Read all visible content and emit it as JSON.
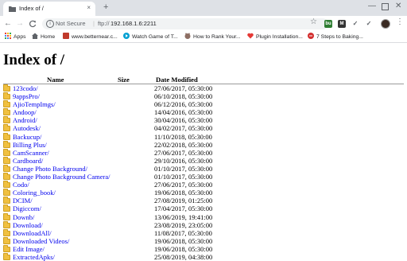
{
  "browser": {
    "tab_title": "Index of /",
    "tab_close": "×",
    "new_tab": "+",
    "window_controls": {
      "minimize": "—",
      "close": "✕"
    },
    "nav": {
      "back": "←",
      "forward": "→",
      "reload": "C"
    },
    "omnibox": {
      "info_icon": "i",
      "security": "Not Secure",
      "separator": "|",
      "scheme": "ftp://",
      "host": "192.168.1.6:2211"
    },
    "star": "☆",
    "extensions": [
      {
        "label": "bu",
        "color": "#2e7d32"
      },
      {
        "label": "M",
        "color": "#333333"
      },
      {
        "label": "✓",
        "color": "#5f6368"
      },
      {
        "label": "✓",
        "color": "#5f6368"
      }
    ],
    "menu": "⋮",
    "bookmarks": [
      {
        "label": "Apps",
        "icon": "apps-grid-icon",
        "color": "#ea4335"
      },
      {
        "label": "Home",
        "icon": "home-icon",
        "color": "#5f6368"
      },
      {
        "label": "www.betternear.c...",
        "icon": "bookmark-favicon",
        "color": "#c0392b"
      },
      {
        "label": "Watch Game of T...",
        "icon": "play-favicon",
        "color": "#00a0d2"
      },
      {
        "label": "How to Rank Your...",
        "icon": "cat-favicon",
        "color": "#8d6e63"
      },
      {
        "label": "Plugin Installation...",
        "icon": "heart-favicon",
        "color": "#e53935"
      },
      {
        "label": "7 Steps to Baking...",
        "icon": "baking-favicon",
        "color": "#d32f2f"
      }
    ]
  },
  "page": {
    "heading": "Index of /",
    "columns": {
      "name": "Name",
      "size": "Size",
      "date": "Date Modified"
    },
    "entries": [
      {
        "name": "123codo/",
        "date": "27/06/2017, 05:30:00"
      },
      {
        "name": "9appsPro/",
        "date": "06/10/2018, 05:30:00"
      },
      {
        "name": "AjioTempImgs/",
        "date": "06/12/2016, 05:30:00"
      },
      {
        "name": "Andoop/",
        "date": "14/04/2016, 05:30:00"
      },
      {
        "name": "Android/",
        "date": "30/04/2016, 05:30:00"
      },
      {
        "name": "Autodesk/",
        "date": "04/02/2017, 05:30:00"
      },
      {
        "name": "Backucup/",
        "date": "11/10/2018, 05:30:00"
      },
      {
        "name": "Billing Plus/",
        "date": "22/02/2018, 05:30:00"
      },
      {
        "name": "CamScanner/",
        "date": "27/06/2017, 05:30:00"
      },
      {
        "name": "Cardboard/",
        "date": "29/10/2016, 05:30:00"
      },
      {
        "name": "Change Photo Background/",
        "date": "01/10/2017, 05:30:00"
      },
      {
        "name": "Change Photo Background Camera/",
        "date": "01/10/2017, 05:30:00"
      },
      {
        "name": "Codo/",
        "date": "27/06/2017, 05:30:00"
      },
      {
        "name": "Coloring_book/",
        "date": "19/06/2018, 05:30:00"
      },
      {
        "name": "DCIM/",
        "date": "27/08/2019, 01:25:00"
      },
      {
        "name": "Digiccom/",
        "date": "17/04/2017, 05:30:00"
      },
      {
        "name": "Downb/",
        "date": "13/06/2019, 19:41:00"
      },
      {
        "name": "Download/",
        "date": "23/08/2019, 23:05:00"
      },
      {
        "name": "DownloadAll/",
        "date": "11/08/2017, 05:30:00"
      },
      {
        "name": "Downloaded Videos/",
        "date": "19/06/2018, 05:30:00"
      },
      {
        "name": "Edit Image/",
        "date": "19/06/2018, 05:30:00"
      },
      {
        "name": "ExtractedApks/",
        "date": "25/08/2019, 04:38:00"
      }
    ]
  }
}
